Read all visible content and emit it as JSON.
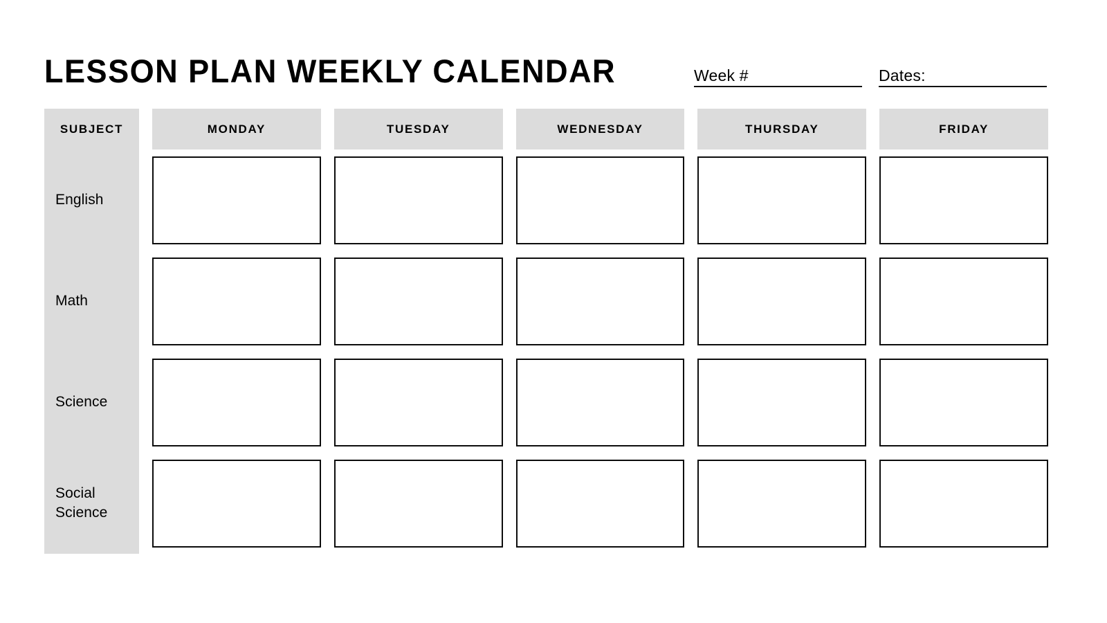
{
  "document": {
    "title": "LESSON PLAN WEEKLY CALENDAR",
    "background_color": "#ffffff",
    "accent_gray": "#dcdcdc",
    "border_color": "#0c0c0c"
  },
  "header": {
    "fields": [
      {
        "label": "Week #",
        "value": ""
      },
      {
        "label": "Dates:",
        "value": ""
      }
    ]
  },
  "table": {
    "columns": [
      {
        "label": "SUBJECT",
        "type": "subject"
      },
      {
        "label": "MONDAY",
        "type": "day"
      },
      {
        "label": "TUESDAY",
        "type": "day"
      },
      {
        "label": "WEDNESDAY",
        "type": "day"
      },
      {
        "label": "THURSDAY",
        "type": "day"
      },
      {
        "label": "FRIDAY",
        "type": "day"
      }
    ],
    "rows": [
      {
        "subject": "English",
        "cells": [
          "",
          "",
          "",
          "",
          ""
        ]
      },
      {
        "subject": "Math",
        "cells": [
          "",
          "",
          "",
          "",
          ""
        ]
      },
      {
        "subject": "Science",
        "cells": [
          "",
          "",
          "",
          "",
          ""
        ]
      },
      {
        "subject": "Social Science",
        "cells": [
          "",
          "",
          "",
          "",
          ""
        ]
      }
    ]
  }
}
